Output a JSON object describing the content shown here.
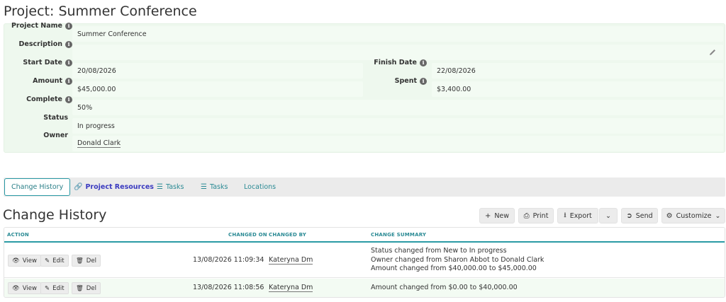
{
  "page": {
    "title": "Project: Summer Conference"
  },
  "details": {
    "project_name": {
      "label": "Project Name",
      "value": "Summer Conference"
    },
    "description": {
      "label": "Description",
      "value": ""
    },
    "start_date": {
      "label": "Start Date",
      "value": "20/08/2026"
    },
    "finish_date": {
      "label": "Finish Date",
      "value": "22/08/2026"
    },
    "amount": {
      "label": "Amount",
      "value": "$45,000.00"
    },
    "spent": {
      "label": "Spent",
      "value": "$3,400.00"
    },
    "complete": {
      "label": "Complete",
      "value": "50%"
    },
    "status": {
      "label": "Status",
      "value": "In progress"
    },
    "owner": {
      "label": "Owner",
      "value": "Donald Clark"
    }
  },
  "tabs": [
    {
      "label": "Change History",
      "icon": "none",
      "active": true
    },
    {
      "label": "Project Resources",
      "icon": "link-icon"
    },
    {
      "label": "Tasks",
      "icon": "list-icon"
    },
    {
      "label": "Tasks",
      "icon": "list-icon"
    },
    {
      "label": "Locations",
      "icon": "none"
    }
  ],
  "section": {
    "title": "Change History"
  },
  "toolbar": {
    "new_label": "New",
    "print_label": "Print",
    "export_label": "Export",
    "send_label": "Send",
    "customize_label": "Customize"
  },
  "table": {
    "columns": {
      "action": "ACTION",
      "changed_on": "CHANGED ON",
      "changed_by": "CHANGED BY",
      "change_summary": "CHANGE SUMMARY"
    },
    "action_labels": {
      "view": "View",
      "edit": "Edit",
      "del": "Del"
    },
    "rows": [
      {
        "changed_on": "13/08/2026 11:09:34",
        "changed_by": "Kateryna Dm",
        "summary": [
          "Status changed from New to In progress",
          "Owner changed from Sharon Abbot to Donald Clark",
          "Amount changed from $40,000.00 to $45,000.00"
        ]
      },
      {
        "changed_on": "13/08/2026 11:08:56",
        "changed_by": "Kateryna Dm",
        "summary": [
          "Amount changed from $0.00 to $40,000.00"
        ]
      }
    ]
  },
  "colors": {
    "accent": "#2a9aa5",
    "panel_bg": "#eef8ee",
    "link": "#3b3bc0"
  }
}
